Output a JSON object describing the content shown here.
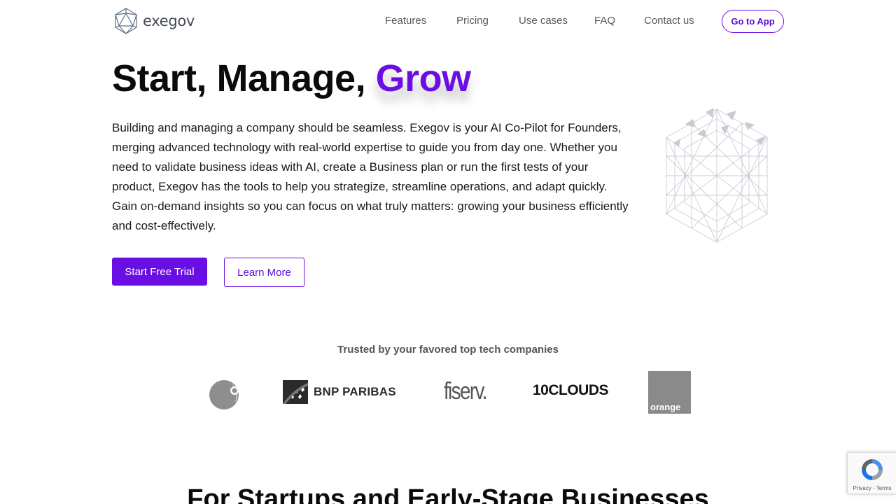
{
  "header": {
    "logo_text": "exegov",
    "nav": {
      "features": "Features",
      "pricing": "Pricing",
      "use_cases": "Use cases",
      "faq": "FAQ",
      "contact": "Contact us"
    },
    "app_button": "Go to App"
  },
  "hero": {
    "title_main": "Start, Manage, ",
    "title_accent": "Grow",
    "description": "Building and managing a company should be seamless. Exegov is your AI Co-Pilot for Founders, merging advanced technology with real-world expertise to guide you from day one. Whether you need to validate business ideas with AI, create a Business plan or run the first tests of your product, Exegov has the tools to help you strategize, streamline operations, and adapt quickly. Gain on-demand insights so you can focus on what truly matters: growing your business efficiently and cost-effectively.",
    "primary_cta": "Start Free Trial",
    "secondary_cta": "Learn More",
    "illustration_icon": "wireframe-geodesic-sphere"
  },
  "trusted": {
    "title": "Trusted by your favored top tech companies",
    "logos": {
      "globe": "globe-logo",
      "bnp": "BNP PARIBAS",
      "fiserv": "fiserv.",
      "tenclouds": "10CLOUDS",
      "orange": "orange"
    }
  },
  "section": {
    "heading": "For Startups and Early-Stage Businesses"
  },
  "recaptcha": {
    "footer": "Privacy - Terms"
  },
  "colors": {
    "accent": "#6a0fe3",
    "text": "#111111",
    "nav_text": "#555a60"
  }
}
